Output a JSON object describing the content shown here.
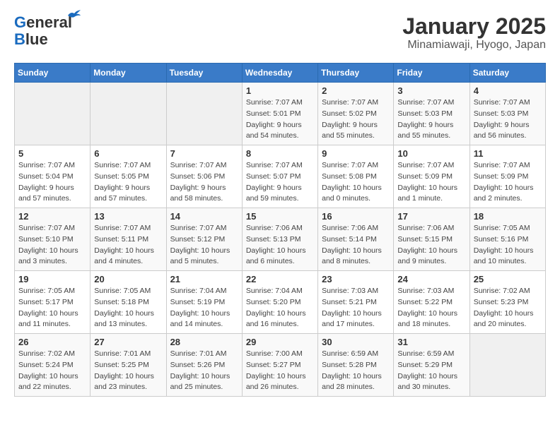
{
  "header": {
    "logo_line1": "General",
    "logo_line2": "Blue",
    "title": "January 2025",
    "subtitle": "Minamiawaji, Hyogo, Japan"
  },
  "calendar": {
    "days_of_week": [
      "Sunday",
      "Monday",
      "Tuesday",
      "Wednesday",
      "Thursday",
      "Friday",
      "Saturday"
    ],
    "weeks": [
      [
        {
          "day": "",
          "info": ""
        },
        {
          "day": "",
          "info": ""
        },
        {
          "day": "",
          "info": ""
        },
        {
          "day": "1",
          "info": "Sunrise: 7:07 AM\nSunset: 5:01 PM\nDaylight: 9 hours\nand 54 minutes."
        },
        {
          "day": "2",
          "info": "Sunrise: 7:07 AM\nSunset: 5:02 PM\nDaylight: 9 hours\nand 55 minutes."
        },
        {
          "day": "3",
          "info": "Sunrise: 7:07 AM\nSunset: 5:03 PM\nDaylight: 9 hours\nand 55 minutes."
        },
        {
          "day": "4",
          "info": "Sunrise: 7:07 AM\nSunset: 5:03 PM\nDaylight: 9 hours\nand 56 minutes."
        }
      ],
      [
        {
          "day": "5",
          "info": "Sunrise: 7:07 AM\nSunset: 5:04 PM\nDaylight: 9 hours\nand 57 minutes."
        },
        {
          "day": "6",
          "info": "Sunrise: 7:07 AM\nSunset: 5:05 PM\nDaylight: 9 hours\nand 57 minutes."
        },
        {
          "day": "7",
          "info": "Sunrise: 7:07 AM\nSunset: 5:06 PM\nDaylight: 9 hours\nand 58 minutes."
        },
        {
          "day": "8",
          "info": "Sunrise: 7:07 AM\nSunset: 5:07 PM\nDaylight: 9 hours\nand 59 minutes."
        },
        {
          "day": "9",
          "info": "Sunrise: 7:07 AM\nSunset: 5:08 PM\nDaylight: 10 hours\nand 0 minutes."
        },
        {
          "day": "10",
          "info": "Sunrise: 7:07 AM\nSunset: 5:09 PM\nDaylight: 10 hours\nand 1 minute."
        },
        {
          "day": "11",
          "info": "Sunrise: 7:07 AM\nSunset: 5:09 PM\nDaylight: 10 hours\nand 2 minutes."
        }
      ],
      [
        {
          "day": "12",
          "info": "Sunrise: 7:07 AM\nSunset: 5:10 PM\nDaylight: 10 hours\nand 3 minutes."
        },
        {
          "day": "13",
          "info": "Sunrise: 7:07 AM\nSunset: 5:11 PM\nDaylight: 10 hours\nand 4 minutes."
        },
        {
          "day": "14",
          "info": "Sunrise: 7:07 AM\nSunset: 5:12 PM\nDaylight: 10 hours\nand 5 minutes."
        },
        {
          "day": "15",
          "info": "Sunrise: 7:06 AM\nSunset: 5:13 PM\nDaylight: 10 hours\nand 6 minutes."
        },
        {
          "day": "16",
          "info": "Sunrise: 7:06 AM\nSunset: 5:14 PM\nDaylight: 10 hours\nand 8 minutes."
        },
        {
          "day": "17",
          "info": "Sunrise: 7:06 AM\nSunset: 5:15 PM\nDaylight: 10 hours\nand 9 minutes."
        },
        {
          "day": "18",
          "info": "Sunrise: 7:05 AM\nSunset: 5:16 PM\nDaylight: 10 hours\nand 10 minutes."
        }
      ],
      [
        {
          "day": "19",
          "info": "Sunrise: 7:05 AM\nSunset: 5:17 PM\nDaylight: 10 hours\nand 11 minutes."
        },
        {
          "day": "20",
          "info": "Sunrise: 7:05 AM\nSunset: 5:18 PM\nDaylight: 10 hours\nand 13 minutes."
        },
        {
          "day": "21",
          "info": "Sunrise: 7:04 AM\nSunset: 5:19 PM\nDaylight: 10 hours\nand 14 minutes."
        },
        {
          "day": "22",
          "info": "Sunrise: 7:04 AM\nSunset: 5:20 PM\nDaylight: 10 hours\nand 16 minutes."
        },
        {
          "day": "23",
          "info": "Sunrise: 7:03 AM\nSunset: 5:21 PM\nDaylight: 10 hours\nand 17 minutes."
        },
        {
          "day": "24",
          "info": "Sunrise: 7:03 AM\nSunset: 5:22 PM\nDaylight: 10 hours\nand 18 minutes."
        },
        {
          "day": "25",
          "info": "Sunrise: 7:02 AM\nSunset: 5:23 PM\nDaylight: 10 hours\nand 20 minutes."
        }
      ],
      [
        {
          "day": "26",
          "info": "Sunrise: 7:02 AM\nSunset: 5:24 PM\nDaylight: 10 hours\nand 22 minutes."
        },
        {
          "day": "27",
          "info": "Sunrise: 7:01 AM\nSunset: 5:25 PM\nDaylight: 10 hours\nand 23 minutes."
        },
        {
          "day": "28",
          "info": "Sunrise: 7:01 AM\nSunset: 5:26 PM\nDaylight: 10 hours\nand 25 minutes."
        },
        {
          "day": "29",
          "info": "Sunrise: 7:00 AM\nSunset: 5:27 PM\nDaylight: 10 hours\nand 26 minutes."
        },
        {
          "day": "30",
          "info": "Sunrise: 6:59 AM\nSunset: 5:28 PM\nDaylight: 10 hours\nand 28 minutes."
        },
        {
          "day": "31",
          "info": "Sunrise: 6:59 AM\nSunset: 5:29 PM\nDaylight: 10 hours\nand 30 minutes."
        },
        {
          "day": "",
          "info": ""
        }
      ]
    ]
  }
}
